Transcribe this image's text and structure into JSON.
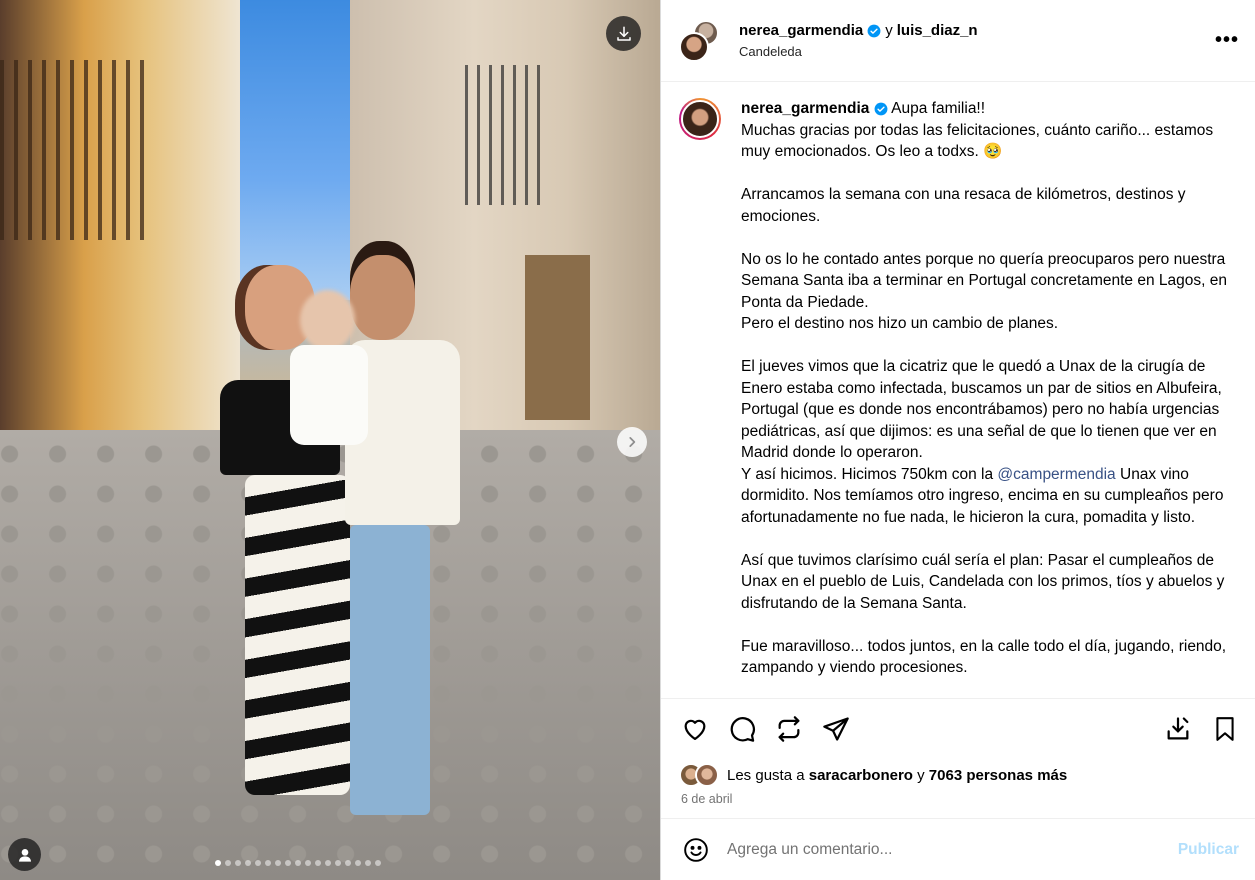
{
  "media": {
    "slides": 17,
    "current_slide": 1
  },
  "header": {
    "user1": "nerea_garmendia",
    "connector": "y",
    "user2": "luis_diaz_n",
    "location": "Candeleda",
    "more": "•••"
  },
  "caption": {
    "username": "nerea_garmendia",
    "intro": "Aupa familia!!",
    "lines": [
      "Muchas gracias por todas las felicitaciones, cuánto cariño... estamos muy emocionados. Os leo a todxs. 🥹",
      "",
      "Arrancamos la semana con una resaca de kilómetros, destinos y emociones.",
      "",
      "No os lo he contado antes porque no quería preocuparos pero nuestra Semana Santa iba a terminar en Portugal concretamente en Lagos, en Ponta da Piedade.",
      "Pero el destino nos hizo un cambio de planes.",
      "",
      "El jueves vimos que la cicatriz que le quedó a Unax de la cirugía de Enero estaba como infectada, buscamos un par de sitios en Albufeira, Portugal (que es donde nos encontrábamos) pero no había urgencias pediátricas, así que dijimos: es una señal de que lo tienen que ver en Madrid donde lo operaron."
    ],
    "line_mention_pre": "Y así hicimos. Hicimos 750km con la ",
    "mention": "@campermendia",
    "line_mention_post": " Unax vino dormidito. Nos temíamos otro ingreso, encima en su cumpleaños pero afortunadamente no fue nada, le hicieron la cura, pomadita y listo.",
    "tail": [
      "",
      "Así que tuvimos clarísimo cuál sería el plan: Pasar el cumpleaños de Unax en el pueblo de Luis, Candelada con los primos, tíos y abuelos y disfrutando de la Semana Santa.",
      "",
      "Fue maravilloso... todos juntos, en la calle todo el día, jugando, riendo, zampando y viendo procesiones."
    ]
  },
  "likes": {
    "prefix": "Les gusta a",
    "user": "saracarbonero",
    "connector": "y",
    "others": "7063 personas más"
  },
  "date": "6 de abril",
  "comment": {
    "placeholder": "Agrega un comentario...",
    "post_label": "Publicar"
  },
  "colors": {
    "verified": "#0095f6",
    "mention": "#385185",
    "post_disabled": "#b2dffc",
    "muted": "#737373"
  }
}
